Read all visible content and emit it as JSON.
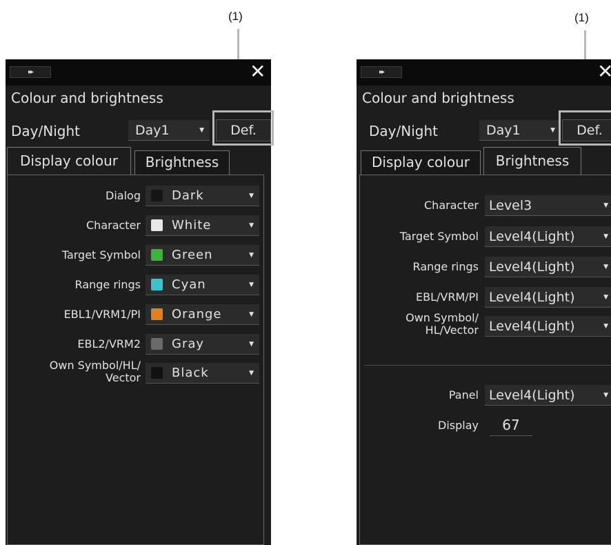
{
  "callout_label": "(1)",
  "colors": {
    "panel_bg": "#1d1d1d",
    "title_bar": "#0b0b0b",
    "highlight": "#b7b7b7"
  },
  "panel": {
    "expand_icon": "▸▸",
    "close_icon": "✕",
    "title": "Colour and brightness",
    "day_night_label": "Day/Night",
    "day_night_value": "Day1",
    "def_button": "Def.",
    "tab_display_colour": "Display colour",
    "tab_brightness": "Brightness"
  },
  "display_colour": {
    "rows": [
      {
        "label": "Dialog",
        "value": "Dark",
        "color": "#1a1a1a"
      },
      {
        "label": "Character",
        "value": "White",
        "color": "#e8e8e8"
      },
      {
        "label": "Target Symbol",
        "value": "Green",
        "color": "#3cb43c"
      },
      {
        "label": "Range rings",
        "value": "Cyan",
        "color": "#40c0cc"
      },
      {
        "label": "EBL1/VRM1/PI",
        "value": "Orange",
        "color": "#e08020"
      },
      {
        "label": "EBL2/VRM2",
        "value": "Gray",
        "color": "#6a6a6a"
      },
      {
        "label_line1": "Own Symbol/HL/",
        "label_line2": "Vector",
        "value": "Black",
        "color": "#111111"
      }
    ]
  },
  "brightness": {
    "rows": [
      {
        "label": "Character",
        "value": "Level3"
      },
      {
        "label": "Target Symbol",
        "value": "Level4(Light)"
      },
      {
        "label": "Range rings",
        "value": "Level4(Light)"
      },
      {
        "label": "EBL/VRM/PI",
        "value": "Level4(Light)"
      },
      {
        "label_line1": "Own Symbol/",
        "label_line2": "HL/Vector",
        "value": "Level4(Light)"
      }
    ],
    "panel_label": "Panel",
    "panel_value": "Level4(Light)",
    "display_label": "Display",
    "display_value": "67"
  }
}
